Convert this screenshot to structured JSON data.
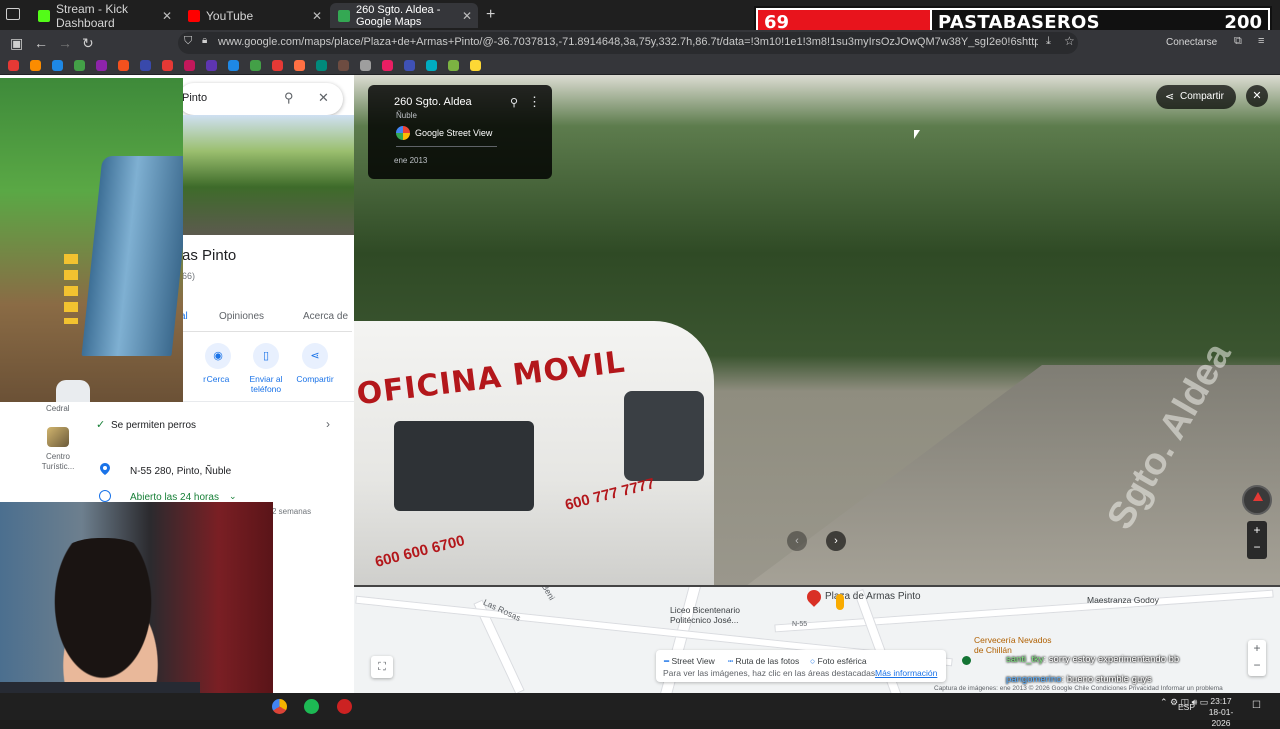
{
  "browser": {
    "tabs": [
      {
        "title": "Stream - Kick Dashboard",
        "favicon_color": "#53fc18",
        "active": false
      },
      {
        "title": "YouTube",
        "favicon_color": "#ff0000",
        "active": false
      },
      {
        "title": "260 Sgto. Aldea - Google Maps",
        "favicon_color": "#34a853",
        "active": true
      }
    ],
    "new_tab": "+",
    "url": "www.google.com/maps/place/Plaza+de+Armas+Pinto/@-36.7037813,-71.8914648,3a,75y,332.7h,86.7t/data=!3m10!1e1!3m8!1su3myIrsOzJOwQM7w38Y_sgI2e0!6shttps:%2F%2Fstreetviewpixels-pa.goog",
    "connect_label": "Conectarse",
    "bookmark_colors": [
      "#e53935",
      "#fb8c00",
      "#1e88e5",
      "#43a047",
      "#8e24aa",
      "#f4511e",
      "#3949ab",
      "#e53935",
      "#c2185b",
      "#5e35b1",
      "#1e88e5",
      "#43a047",
      "#e53935",
      "#ff7043",
      "#00897b",
      "#6d4c41",
      "#9e9e9e",
      "#e91e63",
      "#3f51b5",
      "#00acc1",
      "#7cb342",
      "#fdd835"
    ]
  },
  "score_overlay": {
    "score_left": "69",
    "team_name": "PASTABASEROS",
    "score_right": "200"
  },
  "maps_panel": {
    "search_text": "Pinto",
    "place_title": "as Pinto",
    "review_count": "66)",
    "tabs": [
      "al",
      "Opiniones",
      "Acerca de"
    ],
    "actions": [
      {
        "label": "r"
      },
      {
        "label": "Cerca"
      },
      {
        "label": "Enviar al teléfono"
      },
      {
        "label": "Compartir"
      }
    ],
    "dogs": "Se permiten perros",
    "address": "N-55 280, Pinto, Ñuble",
    "hours": "Abierto las 24 horas",
    "weeks_note": "2 semanas",
    "nearby": [
      {
        "label": "Cedral"
      },
      {
        "label": "Centro Turístic..."
      }
    ]
  },
  "street_view": {
    "card": {
      "title": "260 Sgto. Aldea",
      "subtitle": "Ñuble",
      "source": "Google Street View",
      "date": "ene 2013"
    },
    "share_label": "Compartir",
    "van_text": "OFICINA MOVIL",
    "van_phone_1": "600 777 7777",
    "van_phone_2": "600 600 6700",
    "road_text": "Sgto. Aldea"
  },
  "mini_map": {
    "place_label": "Plaza de Armas Pinto",
    "labels": [
      {
        "text": "Las Rosas",
        "dark": false
      },
      {
        "text": "Liceo Bicentenario Politécnico José...",
        "dark": true
      },
      {
        "text": "Maestranza Godoy",
        "dark": true
      },
      {
        "text": "Cervecería Nevados de Chillán",
        "dark": true
      },
      {
        "text": "N-55",
        "dark": false
      },
      {
        "text": "Beni",
        "dark": false
      }
    ],
    "legend": {
      "street_view": "Street View",
      "photo_route": "Ruta de las fotos",
      "sphere": "Foto esférica",
      "note": "Para ver las imágenes, haz clic en las áreas destacadas.",
      "more": "Más información"
    },
    "footer": "Captura de imágenes: ene 2013   © 2026 Google   Chile   Condiciones   Privacidad   Informar un problema"
  },
  "chat": [
    {
      "user": "santi_tky",
      "message": ": sorry estoy experimentando bb"
    },
    {
      "user": "pangomerino",
      "message": ": bueno stumble guys"
    }
  ],
  "taskbar": {
    "language": "ESP",
    "time": "23:17",
    "date": "18-01-2026"
  }
}
